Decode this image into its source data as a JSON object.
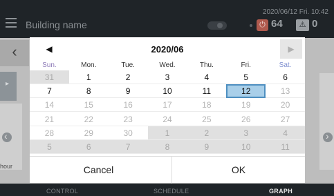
{
  "header": {
    "building_name": "Building name",
    "datetime": "2020/06/12 Fri. 10:42",
    "power_count": "64",
    "alert_count": "0"
  },
  "side": {
    "hour_label": "hour"
  },
  "nav": {
    "control": "CONTROL",
    "schedule": "SCHEDULE",
    "graph": "GRAPH"
  },
  "calendar": {
    "title": "2020/06",
    "weekdays": [
      "Sun.",
      "Mon.",
      "Tue.",
      "Wed.",
      "Thu.",
      "Fri.",
      "Sat."
    ],
    "weeks": [
      [
        {
          "d": "31",
          "m": "other"
        },
        {
          "d": "1",
          "m": "cur"
        },
        {
          "d": "2",
          "m": "cur"
        },
        {
          "d": "3",
          "m": "cur"
        },
        {
          "d": "4",
          "m": "cur"
        },
        {
          "d": "5",
          "m": "cur"
        },
        {
          "d": "6",
          "m": "cur"
        }
      ],
      [
        {
          "d": "7",
          "m": "cur"
        },
        {
          "d": "8",
          "m": "cur"
        },
        {
          "d": "9",
          "m": "cur"
        },
        {
          "d": "10",
          "m": "cur"
        },
        {
          "d": "11",
          "m": "cur"
        },
        {
          "d": "12",
          "m": "sel"
        },
        {
          "d": "13",
          "m": "dis"
        }
      ],
      [
        {
          "d": "14",
          "m": "dis"
        },
        {
          "d": "15",
          "m": "dis"
        },
        {
          "d": "16",
          "m": "dis"
        },
        {
          "d": "17",
          "m": "dis"
        },
        {
          "d": "18",
          "m": "dis"
        },
        {
          "d": "19",
          "m": "dis"
        },
        {
          "d": "20",
          "m": "dis"
        }
      ],
      [
        {
          "d": "21",
          "m": "dis"
        },
        {
          "d": "22",
          "m": "dis"
        },
        {
          "d": "23",
          "m": "dis"
        },
        {
          "d": "24",
          "m": "dis"
        },
        {
          "d": "25",
          "m": "dis"
        },
        {
          "d": "26",
          "m": "dis"
        },
        {
          "d": "27",
          "m": "dis"
        }
      ],
      [
        {
          "d": "28",
          "m": "dis"
        },
        {
          "d": "29",
          "m": "dis"
        },
        {
          "d": "30",
          "m": "dis"
        },
        {
          "d": "1",
          "m": "other"
        },
        {
          "d": "2",
          "m": "other"
        },
        {
          "d": "3",
          "m": "other"
        },
        {
          "d": "4",
          "m": "other"
        }
      ],
      [
        {
          "d": "5",
          "m": "other"
        },
        {
          "d": "6",
          "m": "other"
        },
        {
          "d": "7",
          "m": "other"
        },
        {
          "d": "8",
          "m": "other"
        },
        {
          "d": "9",
          "m": "other"
        },
        {
          "d": "10",
          "m": "other"
        },
        {
          "d": "11",
          "m": "other"
        }
      ]
    ],
    "cancel_label": "Cancel",
    "ok_label": "OK"
  },
  "colors": {
    "sunday": "#8e7bb8",
    "saturday": "#7f8fd0",
    "selected_bg": "#a9cfe9",
    "selected_border": "#4e8fc0",
    "other_month_bg": "#e0e0e0",
    "other_month_text": "#a8a8a8",
    "disabled_text": "#b4b4b4",
    "current_text": "#111111"
  },
  "icons": {
    "menu": "menu-icon",
    "prev": "triangle-left-icon",
    "next": "triangle-right-icon",
    "power": "power-icon",
    "alert": "warning-icon"
  }
}
